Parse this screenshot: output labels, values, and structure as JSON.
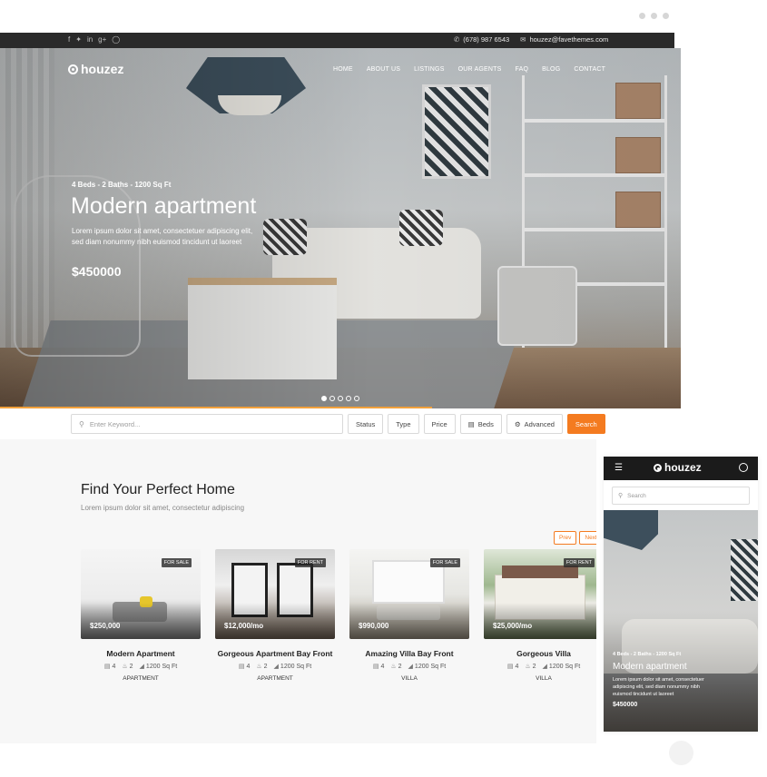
{
  "topbar": {
    "social_icons": [
      "facebook-icon",
      "twitter-icon",
      "linkedin-icon",
      "google-plus-icon",
      "instagram-icon"
    ],
    "phone": "(678) 987 6543",
    "email": "houzez@favethemes.com"
  },
  "brand": {
    "name": "houzez"
  },
  "nav": {
    "items": [
      "HOME",
      "ABOUT US",
      "LISTINGS",
      "OUR AGENTS",
      "FAQ",
      "BLOG",
      "CONTACT"
    ]
  },
  "hero": {
    "meta": "4 Beds - 2 Baths - 1200 Sq Ft",
    "title": "Modern apartment",
    "description": "Lorem ipsum dolor sit amet, consectetuer adipiscing elit, sed diam nonummy nibh euismod tincidunt ut laoreet",
    "price": "$450000",
    "slide_count": 5,
    "active_slide": 1
  },
  "search": {
    "placeholder": "Enter Keyword...",
    "filters": [
      "Status",
      "Type",
      "Price",
      "Beds",
      "Advanced"
    ],
    "submit": "Search"
  },
  "listings": {
    "title": "Find Your Perfect Home",
    "subtitle": "Lorem ipsum dolor sit amet, consectetur adipiscing",
    "prev": "Prev",
    "next": "Next",
    "cards": [
      {
        "badge": "FOR SALE",
        "price": "$250,000",
        "title": "Modern Apartment",
        "beds": "4",
        "baths": "2",
        "area": "1200",
        "area_unit": "Sq Ft",
        "type": "APARTMENT"
      },
      {
        "badge": "FOR RENT",
        "price": "$12,000/mo",
        "title": "Gorgeous Apartment Bay Front",
        "beds": "4",
        "baths": "2",
        "area": "1200",
        "area_unit": "Sq Ft",
        "type": "APARTMENT"
      },
      {
        "badge": "FOR SALE",
        "price": "$990,000",
        "title": "Amazing Villa Bay Front",
        "beds": "4",
        "baths": "2",
        "area": "1200",
        "area_unit": "Sq Ft",
        "type": "VILLA"
      },
      {
        "badge": "FOR RENT",
        "price": "$25,000/mo",
        "title": "Gorgeous Villa",
        "beds": "4",
        "baths": "2",
        "area": "1200",
        "area_unit": "Sq Ft",
        "type": "VILLA"
      }
    ]
  },
  "mobile": {
    "brand": "houzez",
    "search_placeholder": "Search",
    "meta": "4 Beds - 2 Baths - 1200 Sq Ft",
    "title": "Modern apartment",
    "description": "Lorem ipsum dolor sit amet, consectetuer adipiscing elit, sed diam nonummy nibh euismod tincidunt ut laoreet",
    "price": "$450000"
  },
  "colors": {
    "accent": "#f47b20",
    "topbar": "#2a2a2a",
    "progress": "#f2a13c"
  }
}
